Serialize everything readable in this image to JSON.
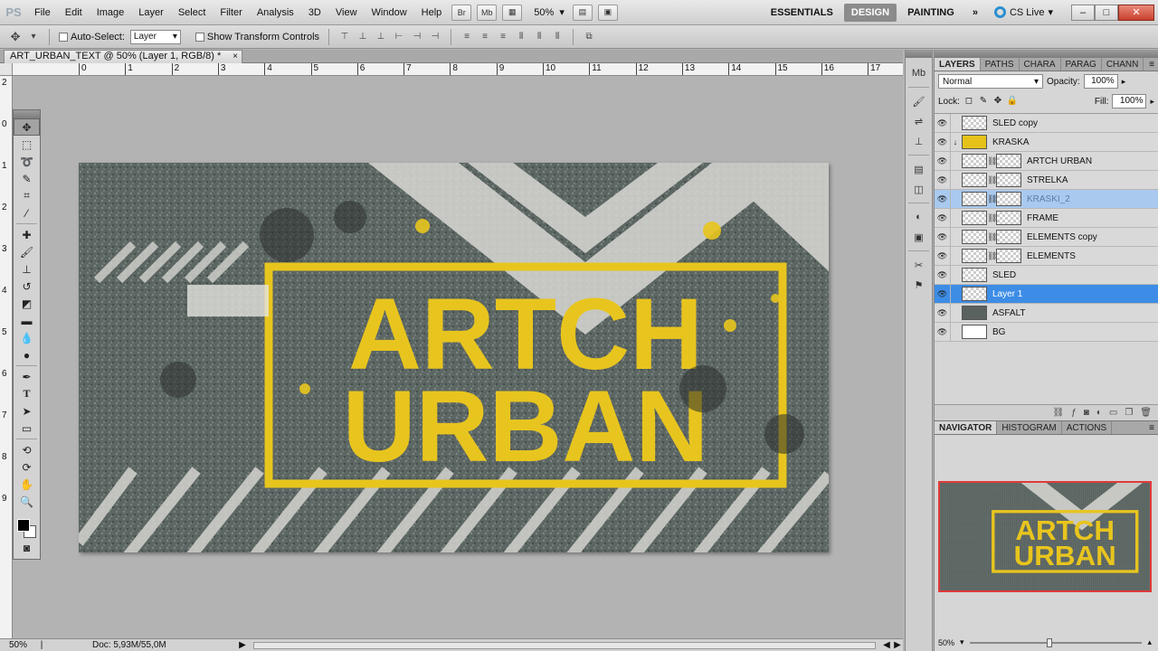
{
  "app": {
    "logo": "PS"
  },
  "menu": [
    "File",
    "Edit",
    "Image",
    "Layer",
    "Select",
    "Filter",
    "Analysis",
    "3D",
    "View",
    "Window",
    "Help"
  ],
  "menubar_buttons": {
    "br": "Br",
    "mb": "Mb"
  },
  "zoom_level": "50%",
  "workspaces": {
    "essentials": "ESSENTIALS",
    "design": "DESIGN",
    "painting": "PAINTING",
    "more": "»"
  },
  "cs_live": "CS Live",
  "window_controls": {
    "minimize": "–",
    "maximize": "□",
    "close": "✕"
  },
  "options": {
    "auto_select_label": "Auto-Select:",
    "auto_select_value": "Layer",
    "transform_controls_label": "Show Transform Controls"
  },
  "document": {
    "tab_title": "ART_URBAN_TEXT @ 50% (Layer 1, RGB/8) *",
    "close": "×"
  },
  "ruler_top": [
    "0",
    "1",
    "2",
    "3",
    "4",
    "5",
    "6",
    "7",
    "8",
    "9",
    "10",
    "11",
    "12",
    "13",
    "14",
    "15",
    "16",
    "17"
  ],
  "ruler_left": [
    "2",
    "0",
    "1",
    "2",
    "3",
    "4",
    "5",
    "6",
    "7",
    "8",
    "9"
  ],
  "status": {
    "zoom": "50%",
    "doc": "Doc: 5,93M/55,0M"
  },
  "canvas_text": {
    "line1": "ARTCH",
    "line2": "URBAN"
  },
  "layers_panel": {
    "tabs": [
      "LAYERS",
      "PATHS",
      "CHARA",
      "PARAG",
      "CHANN"
    ],
    "blend_mode": "Normal",
    "opacity_label": "Opacity:",
    "opacity_value": "100%",
    "lock_label": "Lock:",
    "fill_label": "Fill:",
    "fill_value": "100%",
    "layers": [
      {
        "name": "SLED copy",
        "thumb": "checker",
        "mask": false,
        "indent": false,
        "state": "normal"
      },
      {
        "name": "KRASKA",
        "thumb": "yellow",
        "mask": false,
        "indent": true,
        "state": "normal"
      },
      {
        "name": "ARTCH URBAN",
        "thumb": "checker",
        "mask": true,
        "indent": false,
        "state": "normal"
      },
      {
        "name": "STRELKA",
        "thumb": "checker",
        "mask": true,
        "indent": false,
        "state": "normal"
      },
      {
        "name": "KRASKI_2",
        "thumb": "checker",
        "mask": true,
        "indent": false,
        "state": "dragging"
      },
      {
        "name": "FRAME",
        "thumb": "checker",
        "mask": true,
        "indent": false,
        "state": "normal"
      },
      {
        "name": "ELEMENTS copy",
        "thumb": "checker",
        "mask": true,
        "indent": false,
        "state": "normal"
      },
      {
        "name": "ELEMENTS",
        "thumb": "checker",
        "mask": true,
        "indent": false,
        "state": "normal"
      },
      {
        "name": "SLED",
        "thumb": "checker",
        "mask": false,
        "indent": false,
        "state": "normal"
      },
      {
        "name": "Layer 1",
        "thumb": "checker",
        "mask": false,
        "indent": false,
        "state": "selected"
      },
      {
        "name": "ASFALT",
        "thumb": "dark",
        "mask": false,
        "indent": false,
        "state": "normal"
      },
      {
        "name": "BG",
        "thumb": "white",
        "mask": false,
        "indent": false,
        "state": "normal"
      }
    ]
  },
  "navigator_panel": {
    "tabs": [
      "NAVIGATOR",
      "HISTOGRAM",
      "ACTIONS"
    ],
    "zoom": "50%"
  },
  "colors": {
    "accent_yellow": "#e8c51e",
    "asphalt": "#5f6a66",
    "selection_blue": "#3d8de6"
  }
}
